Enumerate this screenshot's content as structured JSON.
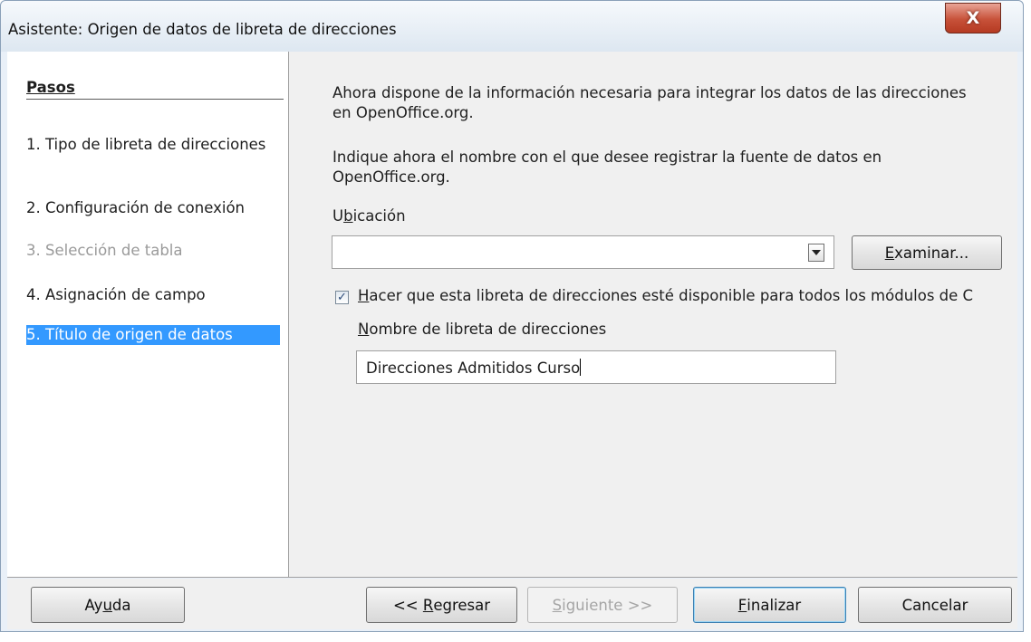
{
  "window": {
    "title": "Asistente: Origen de datos de libreta de direcciones",
    "close_glyph": "X"
  },
  "steps": {
    "heading": "Pasos",
    "items": [
      {
        "label": "1. Tipo de libreta de direcciones",
        "state": "normal"
      },
      {
        "label": "2. Configuración de conexión",
        "state": "normal"
      },
      {
        "label": "3. Selección de tabla",
        "state": "disabled"
      },
      {
        "label": "4. Asignación de campo",
        "state": "normal"
      },
      {
        "label": "5. Título de origen de datos",
        "state": "active"
      }
    ]
  },
  "content": {
    "intro": "Ahora dispone de la información necesaria para integrar los datos de las direcciones en OpenOffice.org.",
    "instruction": "Indique ahora el nombre con el que desee registrar la fuente de datos en OpenOffice.org.",
    "location_label_pre": "U",
    "location_label_mnemonic": "b",
    "location_label_post": "icación",
    "location_value": "",
    "browse_mnemonic": "E",
    "browse_rest": "xaminar...",
    "checkbox_checked": true,
    "checkbox_mnemonic": "H",
    "checkbox_rest": "acer que esta libreta de direcciones esté disponible para todos los módulos de C",
    "name_mnemonic": "N",
    "name_rest": "ombre de libreta de direcciones",
    "name_value": "Direcciones Admitidos Curso"
  },
  "footer": {
    "help_pre": "Ay",
    "help_mnemonic": "u",
    "help_post": "da",
    "back_pre": "<< ",
    "back_mnemonic": "R",
    "back_post": "egresar",
    "next_mnemonic": "S",
    "next_post": "iguiente >>",
    "finish_mnemonic": "F",
    "finish_post": "inalizar",
    "cancel": "Cancelar"
  },
  "colors": {
    "active_step": "#3399ff",
    "disabled_text": "#9a9a9a",
    "close_button": "#c75139"
  },
  "icons": {
    "close": "close-icon",
    "combo_arrow": "chevron-down-icon",
    "checkbox": "checkmark-icon"
  }
}
